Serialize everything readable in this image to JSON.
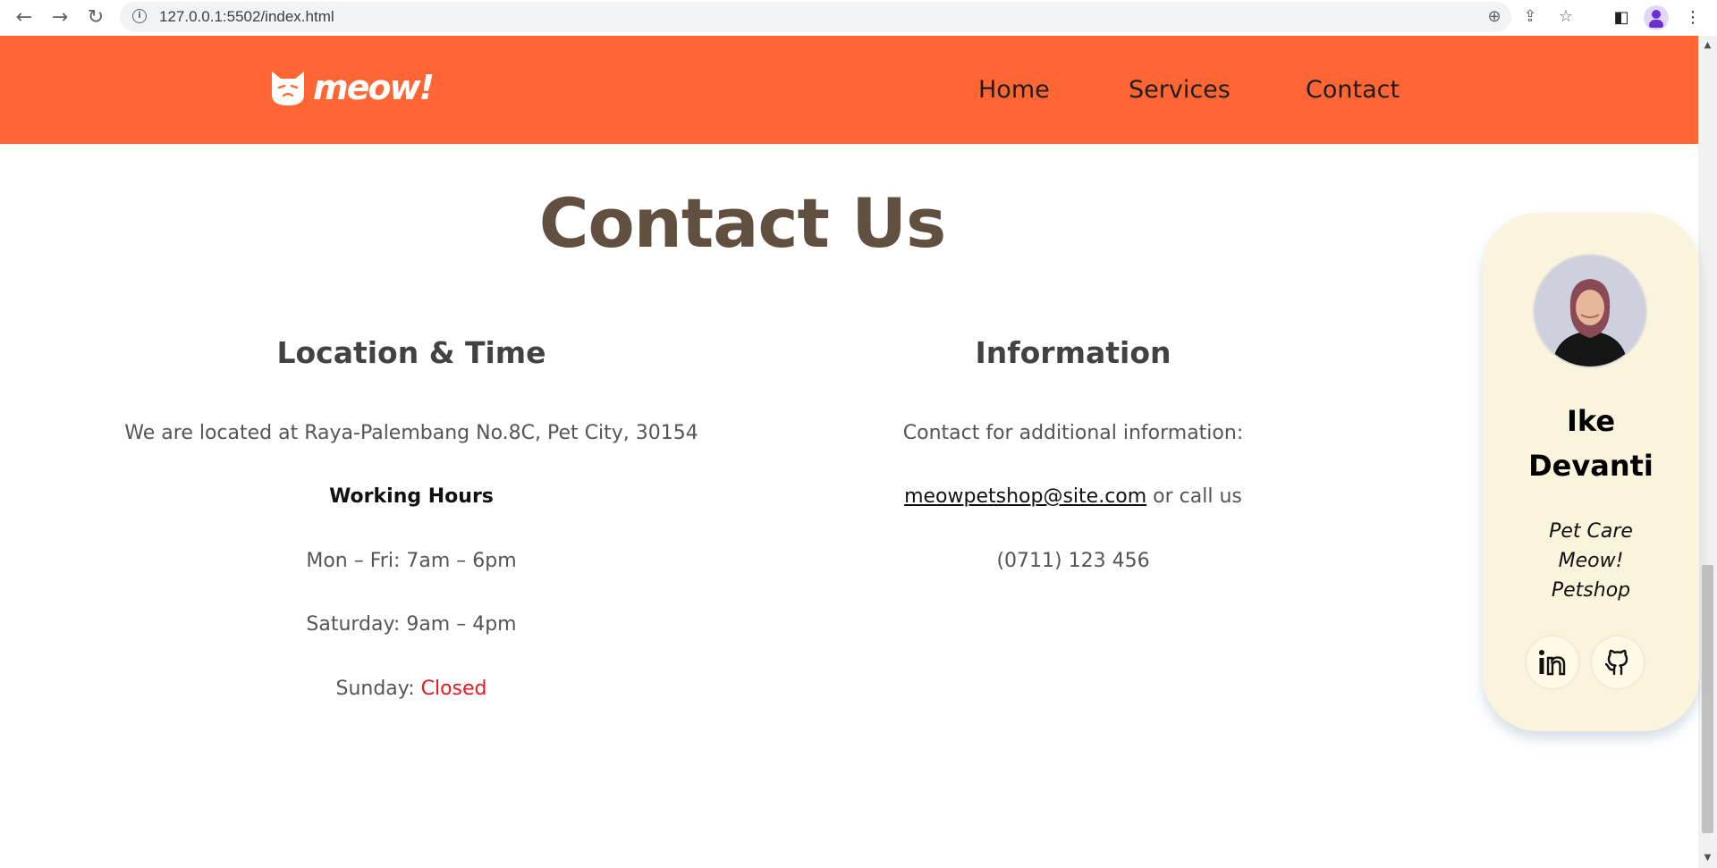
{
  "browser": {
    "url": "127.0.0.1:5502/index.html",
    "back_icon": "back-arrow-icon",
    "forward_icon": "forward-arrow-icon",
    "reload_icon": "reload-icon"
  },
  "site": {
    "logo_text": "meow!",
    "brand_color": "#ff6633",
    "nav": [
      "Home",
      "Services",
      "Contact"
    ]
  },
  "contact": {
    "title": "Contact Us",
    "location": {
      "heading": "Location & Time",
      "address": "We are located at Raya-Palembang No.8C, Pet City, 30154",
      "hours_label": "Working Hours",
      "weekday": "Mon – Fri: 7am – 6pm",
      "saturday": "Saturday: 9am – 4pm",
      "sunday_label": "Sunday: ",
      "sunday_status": "Closed"
    },
    "info": {
      "heading": "Information",
      "line1": "Contact for additional information:",
      "email": "meowpetshop@site.com",
      "call_text": " or call us",
      "phone": "(0711) 123 456"
    }
  },
  "profile": {
    "name_line1": "Ike",
    "name_line2": "Devanti",
    "role_line1": "Pet Care",
    "role_line2": "Meow!",
    "role_line3": "Petshop",
    "linkedin_icon": "linkedin-icon",
    "github_icon": "github-icon"
  }
}
